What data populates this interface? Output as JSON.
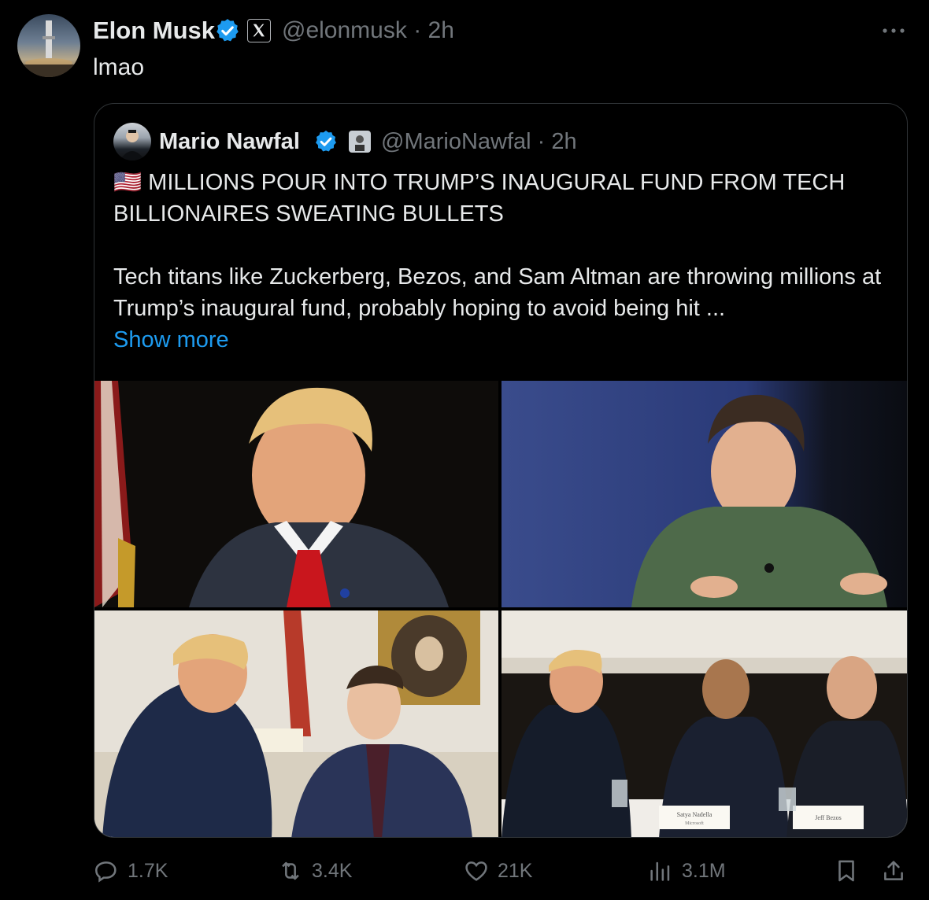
{
  "tweet": {
    "author_name": "Elon Musk",
    "author_handle": "@elonmusk",
    "separator": "·",
    "time": "2h",
    "text": "lmao",
    "more_icon": "more-horizontal-icon"
  },
  "quote": {
    "author_name": "Mario Nawfal",
    "author_handle": "@MarioNawfal",
    "separator": "·",
    "time": "2h",
    "flag": "🇺🇸",
    "headline": "MILLIONS POUR INTO TRUMP’S INAUGURAL FUND FROM TECH BILLIONAIRES SWEATING BULLETS",
    "body": "Tech titans like  Zuckerberg, Bezos, and Sam Altman are throwing millions at Trump’s inaugural fund, probably hoping to avoid being hit ...",
    "show_more": "Show more",
    "images": [
      {
        "label": "trump-portrait"
      },
      {
        "label": "altman-portrait"
      },
      {
        "label": "trump-zuckerberg-handshake"
      },
      {
        "label": "trump-nadella-bezos-table"
      }
    ],
    "image_captions": [
      "Satya Nadella",
      "Microsoft",
      "Jeff Bezos"
    ]
  },
  "actions": {
    "replies": "1.7K",
    "reposts": "3.4K",
    "likes": "21K",
    "views": "3.1M"
  },
  "colors": {
    "background": "#000000",
    "text": "#e7e9ea",
    "muted": "#71767b",
    "accent": "#1d9bf0",
    "border": "#2f3336"
  }
}
